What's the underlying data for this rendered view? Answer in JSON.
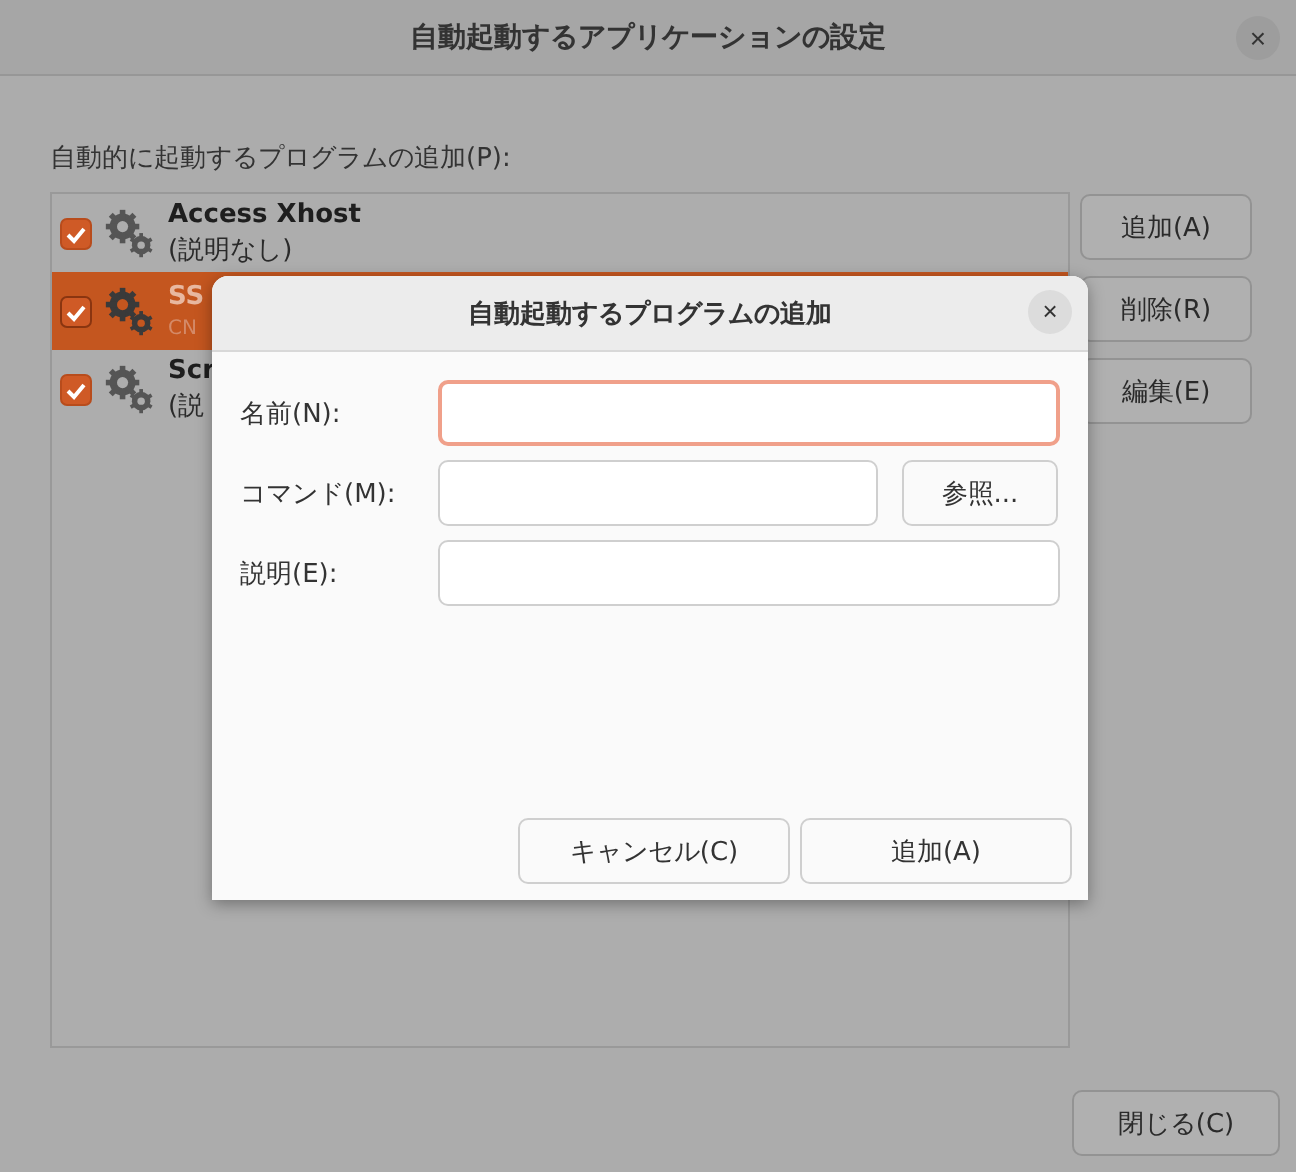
{
  "window": {
    "title": "自動起動するアプリケーションの設定",
    "close": "×"
  },
  "list_label": "自動的に起動するプログラムの追加(P):",
  "programs": [
    {
      "name": "Access Xhost",
      "description": "(説明なし)",
      "enabled": true,
      "selected": false
    },
    {
      "name": "SS",
      "description": "CN",
      "enabled": true,
      "selected": true
    },
    {
      "name": "Scr",
      "description": "(説",
      "enabled": true,
      "selected": false
    }
  ],
  "side_buttons": [
    "追加(A)",
    "削除(R)",
    "編集(E)"
  ],
  "close_button": "閉じる(C)",
  "dialog": {
    "title": "自動起動するプログラムの追加",
    "close": "×",
    "fields": [
      {
        "label": "名前(N):",
        "kind": "text",
        "focused": true
      },
      {
        "label": "コマンド(M):",
        "kind": "browse",
        "focused": false,
        "button": "参照..."
      },
      {
        "label": "説明(E):",
        "kind": "text",
        "focused": false
      }
    ],
    "buttons": [
      "キャンセル(C)",
      "追加(A)"
    ]
  }
}
